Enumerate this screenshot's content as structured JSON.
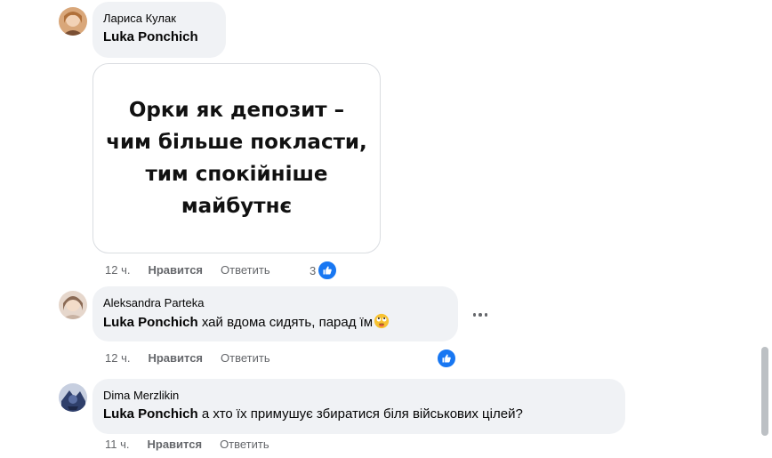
{
  "comments": [
    {
      "author": "Лариса Кулак",
      "mention": "Luka Ponchich",
      "text": "",
      "avatar": "avatar-larysa"
    },
    {
      "author": "Aleksandra Parteka",
      "mention": "Luka Ponchich",
      "text": " хай вдома сидять, парад їм",
      "emoji": "rolling-eyes-emoji",
      "avatar": "avatar-aleksandra"
    },
    {
      "author": "Dima Merzlikin",
      "mention": "Luka Ponchich",
      "text": " а хто їх примушує збиратися біля військових цілей?",
      "avatar": "avatar-dima"
    }
  ],
  "meme": {
    "text": "Орки як депозит –\nчим більше покласти,\nтим спокійніше\nмайбутнє"
  },
  "actions": [
    {
      "time": "12 ч.",
      "like_label": "Нравится",
      "reply_label": "Ответить",
      "reaction_count": "3"
    },
    {
      "time": "12 ч.",
      "like_label": "Нравится",
      "reply_label": "Ответить",
      "reaction_count": ""
    },
    {
      "time": "11 ч.",
      "like_label": "Нравится",
      "reply_label": "Ответить"
    }
  ],
  "colors": {
    "bubble": "#f0f2f5",
    "like_blue": "#1877f2",
    "secondary_text": "#65676b"
  },
  "icons": {
    "more": "more-horizontal-icon",
    "like": "thumbs-up-icon"
  }
}
